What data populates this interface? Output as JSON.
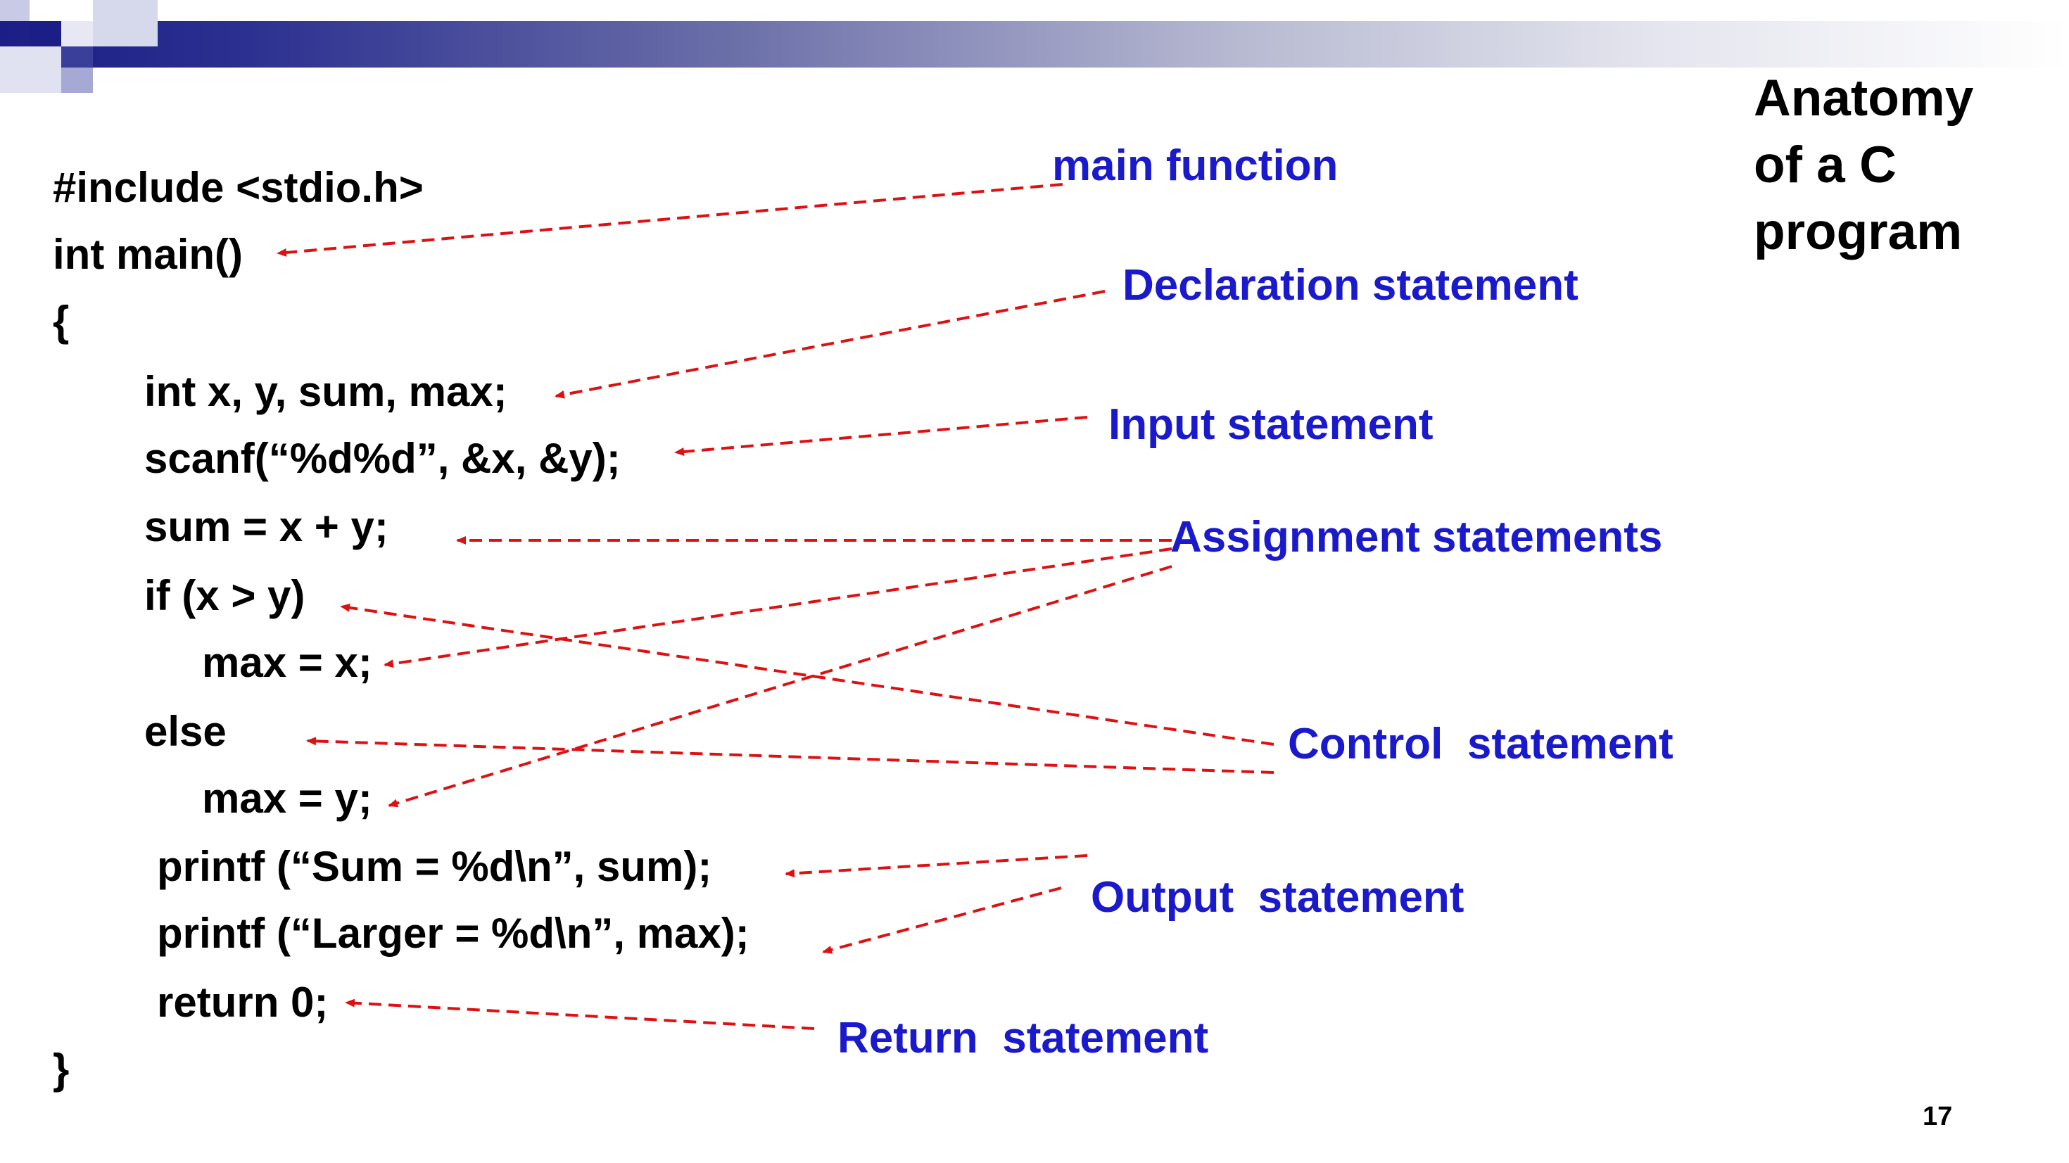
{
  "slide": {
    "title": "Anatomy\nof a C\nprogram",
    "page_number": "17"
  },
  "code_lines": [
    "#include <stdio.h>",
    "int main()",
    "{",
    "int x, y, sum, max;",
    "scanf(“%d%d”, &x, &y);",
    "sum = x + y;",
    "if (x > y)",
    "max = x;",
    "else",
    "max = y;",
    "printf (“Sum = %d\\n”, sum);",
    "printf (“Larger = %d\\n”, max);",
    "return 0;",
    "}"
  ],
  "labels": {
    "main_function": "main function",
    "declaration": "Declaration statement",
    "input": "Input statement",
    "assignment": "Assignment statements",
    "control": "Control  statement",
    "output": "Output  statement",
    "return": "Return  statement"
  },
  "colors": {
    "code_text": "#000000",
    "label_text": "#1a1acc",
    "arrow": "#dd1111",
    "header_dark": "#1a1e86"
  }
}
